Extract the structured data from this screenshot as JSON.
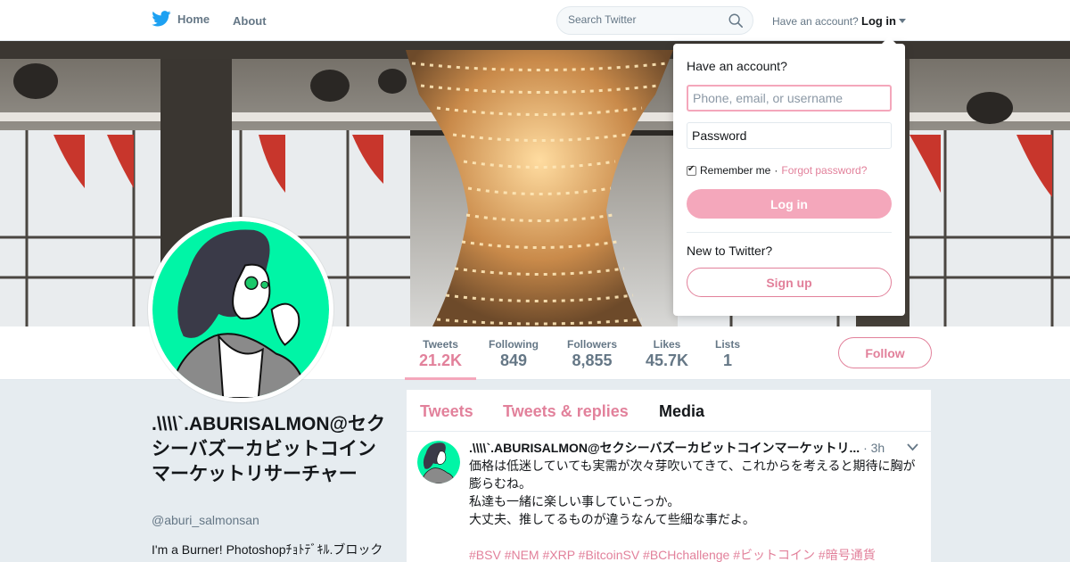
{
  "topbar": {
    "home_label": "Home",
    "about_label": "About",
    "search_placeholder": "Search Twitter",
    "account_text": "Have an account?",
    "login_label": "Log in"
  },
  "profile": {
    "name": ".\\\\\\\\`.ABURISALMON@セクシーバズーカビットコインマーケットリサーチャー",
    "handle": "@aburi_salmonsan",
    "bio": "I'm a Burner! Photoshopﾁｮﾄﾃﾞｷﾙ.ブロック"
  },
  "stats": [
    {
      "label": "Tweets",
      "value": "21.2K"
    },
    {
      "label": "Following",
      "value": "849"
    },
    {
      "label": "Followers",
      "value": "8,855"
    },
    {
      "label": "Likes",
      "value": "45.7K"
    },
    {
      "label": "Lists",
      "value": "1"
    }
  ],
  "follow_label": "Follow",
  "timeline": {
    "tabs": [
      "Tweets",
      "Tweets & replies",
      "Media"
    ],
    "selected_tab": "Media",
    "tweet": {
      "name": ".\\\\\\\\`.ABURISALMON@セクシーバズーカビットコインマーケットリ...",
      "time": "· 3h",
      "lines": [
        "価格は低迷していても実需が次々芽吹いてきて、これからを考えると期待に胸が膨らむね。",
        "私達も一緒に楽しい事していこっか。",
        "大丈夫、推してるものが違うなんて些細な事だよ。"
      ],
      "hashtags": "#BSV #NEM #XRP #BitcoinSV #BCHchallenge #ビットコイン #暗号通貨"
    }
  },
  "login_dropdown": {
    "heading": "Have an account?",
    "username_placeholder": "Phone, email, or username",
    "password_placeholder": "Password",
    "remember_label": "Remember me",
    "separator": "·",
    "forgot_label": "Forgot password?",
    "login_button": "Log in",
    "new_text": "New to Twitter?",
    "signup_button": "Sign up"
  },
  "colors": {
    "accent": "#e2819b",
    "accent_light": "#f4a7bb",
    "twitter_blue": "#1da1f2",
    "avatar_bg": "#00f5a6"
  },
  "icons": [
    "twitter-bird-icon",
    "search-icon",
    "chevron-down-icon",
    "checkbox-icon"
  ]
}
